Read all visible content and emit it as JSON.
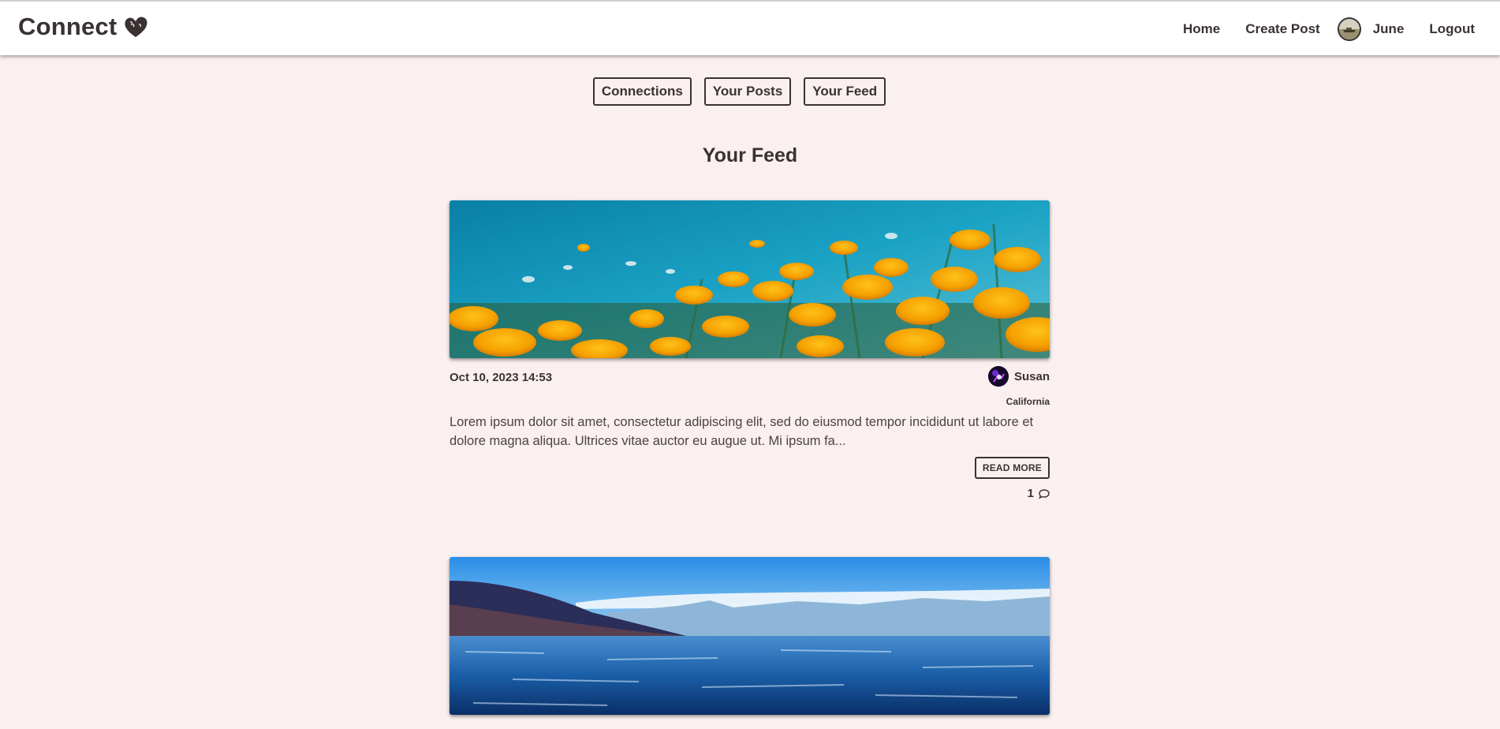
{
  "nav": {
    "brand": "Connect",
    "home": "Home",
    "create_post": "Create Post",
    "user_name": "June",
    "logout": "Logout"
  },
  "tabs": [
    "Connections",
    "Your Posts",
    "Your Feed"
  ],
  "feed_title": "Your Feed",
  "posts": [
    {
      "date": "Oct 10, 2023 14:53",
      "author": "Susan",
      "location": "California",
      "excerpt": "Lorem ipsum dolor sit amet, consectetur adipiscing elit, sed do eiusmod tempor incididunt ut labore et dolore magna aliqua. Ultrices vitae auctor eu augue ut. Mi ipsum fa...",
      "read_more": "READ MORE",
      "comment_count": "1",
      "image": "orange-poppies-field"
    },
    {
      "image": "mountain-lake"
    }
  ],
  "colors": {
    "background": "#fbf0f0",
    "text": "#3a3232",
    "navbar": "#ffffff"
  }
}
